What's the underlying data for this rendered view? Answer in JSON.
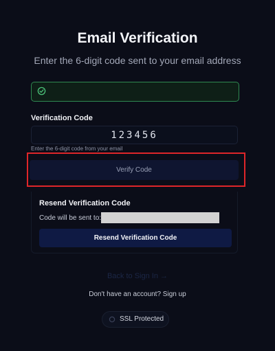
{
  "header": {
    "title": "Email Verification",
    "subtitle": "Enter the 6-digit code sent to your email address"
  },
  "success_banner": {
    "icon": "check-circle-icon",
    "color": "#2f8a52",
    "text": ""
  },
  "code_form": {
    "label": "Verification Code",
    "value": "123456",
    "hint": "Enter the 6-digit code from your email",
    "verify_label": "Verify Code"
  },
  "resend": {
    "title": "Resend Verification Code",
    "sent_to_label": "Code will be sent to:",
    "button_label": "Resend Verification Code"
  },
  "footer": {
    "back_link": "Back to Sign In →",
    "signup": "Don't have an account? Sign up",
    "ssl_badge": "SSL Protected",
    "ssl_icon": "lock-icon"
  },
  "colors": {
    "background": "#0b0d18",
    "accent_button": "#0f1a44",
    "highlight": "#e0262a"
  }
}
